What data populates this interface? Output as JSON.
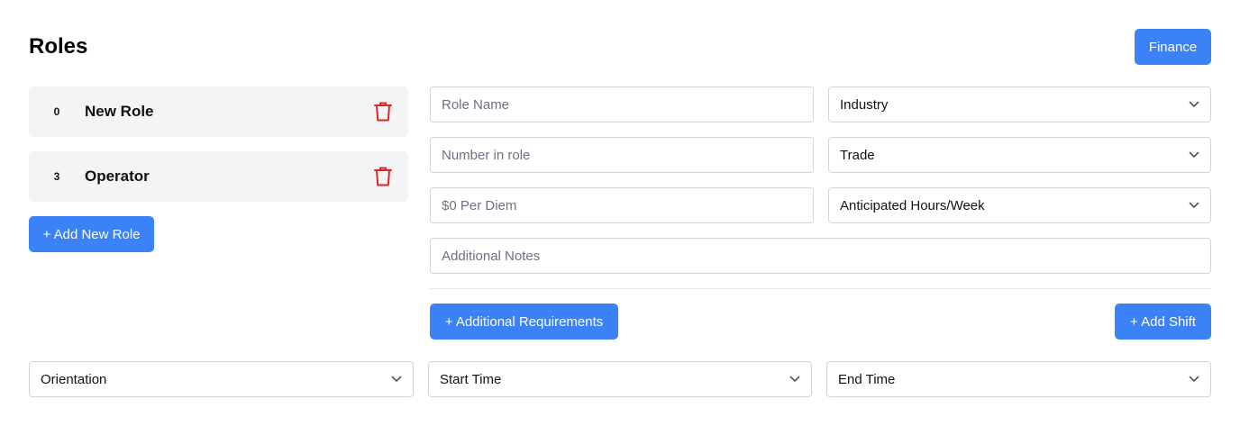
{
  "header": {
    "title": "Roles",
    "finance_button": "Finance"
  },
  "roles": [
    {
      "count": "0",
      "name": "New Role"
    },
    {
      "count": "3",
      "name": "Operator"
    }
  ],
  "add_role_button": "+ Add New Role",
  "form": {
    "role_name_placeholder": "Role Name",
    "number_in_role_placeholder": "Number in role",
    "per_diem_placeholder": "$0 Per Diem",
    "notes_placeholder": "Additional Notes",
    "industry_select": "Industry",
    "trade_select": "Trade",
    "hours_select": "Anticipated Hours/Week",
    "additional_requirements_button": "+ Additional Requirements",
    "add_shift_button": "+ Add Shift"
  },
  "shift": {
    "orientation_select": "Orientation",
    "start_time_select": "Start Time",
    "end_time_select": "End Time"
  },
  "colors": {
    "primary": "#3b82f6",
    "danger": "#dc2626",
    "card_bg": "#f3f4f6",
    "border": "#d1d5db"
  }
}
